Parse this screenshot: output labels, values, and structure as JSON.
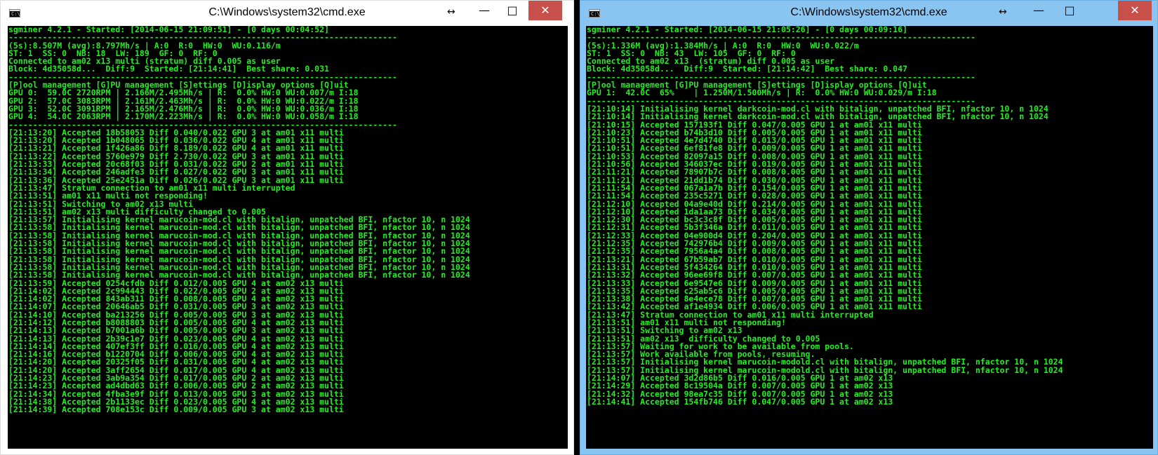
{
  "left_window": {
    "title": "C:\\Windows\\system32\\cmd.exe",
    "icon": "cmd-icon",
    "controls": {
      "resize": "↔",
      "minimize": "—",
      "maximize": "□",
      "close": "✕"
    },
    "lines": [
      "sgminer 4.2.1 - Started: [2014-06-15 21:09:51] - [0 days 00:04:52]",
      "--------------------------------------------------------------------------------",
      "(5s):8.507M (avg):8.797Mh/s | A:0  R:0  HW:0  WU:0.116/m",
      "ST: 1  SS: 0  NB: 18  LW: 189  GF: 0  RF: 0",
      "Connected to am02 x13 multi (stratum) diff 0.005 as user",
      "Block: 4d35058d...  Diff:9  Started: [21:14:41]  Best share: 0.031",
      "--------------------------------------------------------------------------------",
      "[P]ool management [G]PU management [S]ettings [D]isplay options [Q]uit",
      "GPU 0:  59.0C 2720RPM | 2.166M/2.495Mh/s | R:  0.0% HW:0 WU:0.007/m I:18",
      "GPU 2:  57.0C 3083RPM | 2.161M/2.463Mh/s | R:  0.0% HW:0 WU:0.022/m I:18",
      "GPU 3:  52.0C 3091RPM | 2.165M/2.476Mh/s | R:  0.0% HW:0 WU:0.036/m I:18",
      "GPU 4:  54.0C 2063RPM | 2.170M/2.223Mh/s | R:  0.0% HW:0 WU:0.058/m I:18",
      "--------------------------------------------------------------------------------",
      "[21:13:20] Accepted 18b58053 Diff 0.040/0.022 GPU 3 at am01 x11 multi",
      "[21:13:20] Accepted 1b048065 Diff 0.036/0.022 GPU 4 at am01 x11 multi",
      "[21:13:21] Accepted 1f426a86 Diff 8.189/0.022 GPU 4 at am01 x11 multi",
      "[21:13:22] Accepted 5760e979 Diff 2.730/0.022 GPU 3 at am01 x11 multi",
      "[21:13:33] Accepted 20c68f03 Diff 0.031/0.022 GPU 2 at am01 x11 multi",
      "[21:13:34] Accepted 246adfe3 Diff 0.027/0.022 GPU 3 at am01 x11 multi",
      "[21:13:36] Accepted 25e2451a Diff 0.026/0.022 GPU 3 at am01 x11 multi",
      "[21:13:47] Stratum connection to am01 x11 multi interrupted",
      "[21:13:51] am01 x11 multi not responding!",
      "[21:13:51] Switching to am02 x13 multi",
      "[21:13:51] am02 x13 multi difficulty changed to 0.005",
      "[21:13:57] Initialising kernel marucoin-mod.cl with bitalign, unpatched BFI, nfactor 10, n 1024",
      "[21:13:58] Initialising kernel marucoin-mod.cl with bitalign, unpatched BFI, nfactor 10, n 1024",
      "[21:13:58] Initialising kernel marucoin-mod.cl with bitalign, unpatched BFI, nfactor 10, n 1024",
      "[21:13:58] Initialising kernel marucoin-mod.cl with bitalign, unpatched BFI, nfactor 10, n 1024",
      "[21:13:58] Initialising kernel marucoin-mod.cl with bitalign, unpatched BFI, nfactor 10, n 1024",
      "[21:13:58] Initialising kernel marucoin-mod.cl with bitalign, unpatched BFI, nfactor 10, n 1024",
      "[21:13:58] Initialising kernel marucoin-mod.cl with bitalign, unpatched BFI, nfactor 10, n 1024",
      "[21:13:58] Initialising kernel marucoin-mod.cl with bitalign, unpatched BFI, nfactor 10, n 1024",
      "[21:13:59] Accepted 0254cfdb Diff 0.012/0.005 GPU 4 at am02 x13 multi",
      "[21:14:02] Accepted 2c994443 Diff 0.022/0.005 GPU 2 at am02 x13 multi",
      "[21:14:02] Accepted 843ab311 Diff 0.008/0.005 GPU 4 at am02 x13 multi",
      "[21:14:07] Accepted 20646ab5 Diff 0.031/0.005 GPU 3 at am02 x13 multi",
      "[21:14:10] Accepted ba213256 Diff 0.005/0.005 GPU 3 at am02 x13 multi",
      "[21:14:12] Accepted b8088803 Diff 0.005/0.005 GPU 4 at am02 x13 multi",
      "[21:14:13] Accepted b7001a6b Diff 0.005/0.005 GPU 3 at am02 x13 multi",
      "[21:14:13] Accepted 2b39c1e7 Diff 0.023/0.005 GPU 4 at am02 x13 multi",
      "[21:14:14] Accepted 407ef3ff Diff 0.016/0.005 GPU 4 at am02 x13 multi",
      "[21:14:16] Accepted b1220704 Diff 0.006/0.005 GPU 4 at am02 x13 multi",
      "[21:14:20] Accepted 20325f05 Diff 0.031/0.005 GPU 4 at am02 x13 multi",
      "[21:14:20] Accepted 3aff2654 Diff 0.017/0.005 GPU 4 at am02 x13 multi",
      "[21:14:23] Accepted 3ab9a354 Diff 0.017/0.005 GPU 2 at am02 x13 multi",
      "[21:14:23] Accepted ad4dbd63 Diff 0.006/0.005 GPU 2 at am02 x13 multi",
      "[21:14:34] Accepted 4fba3e9f Diff 0.013/0.005 GPU 3 at am02 x13 multi",
      "[21:14:38] Accepted 2b1133ec Diff 0.023/0.005 GPU 4 at am02 x13 multi",
      "[21:14:39] Accepted 708e153c Diff 0.009/0.005 GPU 3 at am02 x13 multi"
    ]
  },
  "right_window": {
    "title": "C:\\Windows\\system32\\cmd.exe",
    "icon": "cmd-icon",
    "controls": {
      "resize": "↔",
      "minimize": "—",
      "maximize": "□",
      "close": "✕"
    },
    "lines": [
      "sgminer 4.2.1 - Started: [2014-06-15 21:05:26] - [0 days 00:09:16]",
      "--------------------------------------------------------------------------------",
      "(5s):1.336M (avg):1.384Mh/s | A:0  R:0  HW:0  WU:0.022/m",
      "ST: 1  SS: 0  NB: 43  LW: 105  GF: 0  RF: 0",
      "Connected to am02 x13  (stratum) diff 0.005 as user",
      "Block: 4d35058d...  Diff:9  Started: [21:14:42]  Best share: 0.047",
      "--------------------------------------------------------------------------------",
      "[P]ool management [G]PU management [S]ettings [D]isplay options [Q]uit",
      "GPU 1:  42.0C  65%    | 1.250M/1.500Mh/s | R:  0.0% HW:0 WU:0.029/m I:18",
      "--------------------------------------------------------------------------------",
      "[21:10:14] Initialising kernel darkcoin-mod.cl with bitalign, unpatched BFI, nfactor 10, n 1024",
      "[21:10:14] Initialising kernel darkcoin-mod.cl with bitalign, unpatched BFI, nfactor 10, n 1024",
      "[21:10:15] Accepted 157193f1 Diff 0.047/0.005 GPU 1 at am01 x11 multi",
      "[21:10:23] Accepted b74b3d10 Diff 0.005/0.005 GPU 1 at am01 x11 multi",
      "[21:10:51] Accepted 4e7d4740 Diff 0.013/0.005 GPU 1 at am01 x11 multi",
      "[21:10:51] Accepted 6ef81fe8 Diff 0.009/0.005 GPU 1 at am01 x11 multi",
      "[21:10:53] Accepted 82097a15 Diff 0.008/0.005 GPU 1 at am01 x11 multi",
      "[21:10:56] Accepted 346037ec Diff 0.019/0.005 GPU 1 at am01 x11 multi",
      "[21:11:21] Accepted 78907b7c Diff 0.008/0.005 GPU 1 at am01 x11 multi",
      "[21:11:21] Accepted 21dd1b74 Diff 0.030/0.005 GPU 1 at am01 x11 multi",
      "[21:11:54] Accepted 067a1a7b Diff 0.154/0.005 GPU 1 at am01 x11 multi",
      "[21:11:54] Accepted 235c5271 Diff 0.028/0.005 GPU 1 at am01 x11 multi",
      "[21:12:10] Accepted 04a9e40d Diff 0.214/0.005 GPU 1 at am01 x11 multi",
      "[21:12:10] Accepted 1da1aa73 Diff 0.034/0.005 GPU 1 at am01 x11 multi",
      "[21:12:30] Accepted bc3c3c8f Diff 0.005/0.005 GPU 1 at am01 x11 multi",
      "[21:12:31] Accepted 5b3f346a Diff 0.011/0.005 GPU 1 at am01 x11 multi",
      "[21:12:33] Accepted 04e900d4 Diff 0.204/0.005 GPU 1 at am01 x11 multi",
      "[21:12:35] Accepted 742976b4 Diff 0.009/0.005 GPU 1 at am01 x11 multi",
      "[21:12:35] Accepted 7956a4a4 Diff 0.008/0.005 GPU 1 at am01 x11 multi",
      "[21:13:21] Accepted 67b59ab7 Diff 0.010/0.005 GPU 1 at am01 x11 multi",
      "[21:13:31] Accepted 5f434264 Diff 0.010/0.005 GPU 1 at am01 x11 multi",
      "[21:13:32] Accepted 96ee69f8 Diff 0.007/0.005 GPU 1 at am01 x11 multi",
      "[21:13:33] Accepted 6e9547e6 Diff 0.009/0.005 GPU 1 at am01 x11 multi",
      "[21:13:35] Accepted c25ab5c6 Diff 0.005/0.005 GPU 1 at am01 x11 multi",
      "[21:13:38] Accepted 8e4ece78 Diff 0.007/0.005 GPU 1 at am01 x11 multi",
      "[21:13:42] Accepted af1e4934 Diff 0.006/0.005 GPU 1 at am01 x11 multi",
      "[21:13:47] Stratum connection to am01 x11 multi interrupted",
      "[21:13:51] am01 x11 multi not responding!",
      "[21:13:51] Switching to am02 x13",
      "[21:13:51] am02 x13  difficulty changed to 0.005",
      "[21:13:57] Waiting for work to be available from pools.",
      "[21:13:57] Work available from pools, resuming.",
      "[21:13:57] Initialising kernel marucoin-modold.cl with bitalign, unpatched BFI, nfactor 10, n 1024",
      "[21:13:57] Initialising kernel marucoin-modold.cl with bitalign, unpatched BFI, nfactor 10, n 1024",
      "[21:14:07] Accepted 3d2d86b5 Diff 0.016/0.005 GPU 1 at am02 x13",
      "[21:14:29] Accepted 8c19504a Diff 0.007/0.005 GPU 1 at am02 x13",
      "[21:14:32] Accepted 98ea7c35 Diff 0.007/0.005 GPU 1 at am02 x13",
      "[21:14:41] Accepted 154fb746 Diff 0.047/0.005 GPU 1 at am02 x13"
    ]
  }
}
